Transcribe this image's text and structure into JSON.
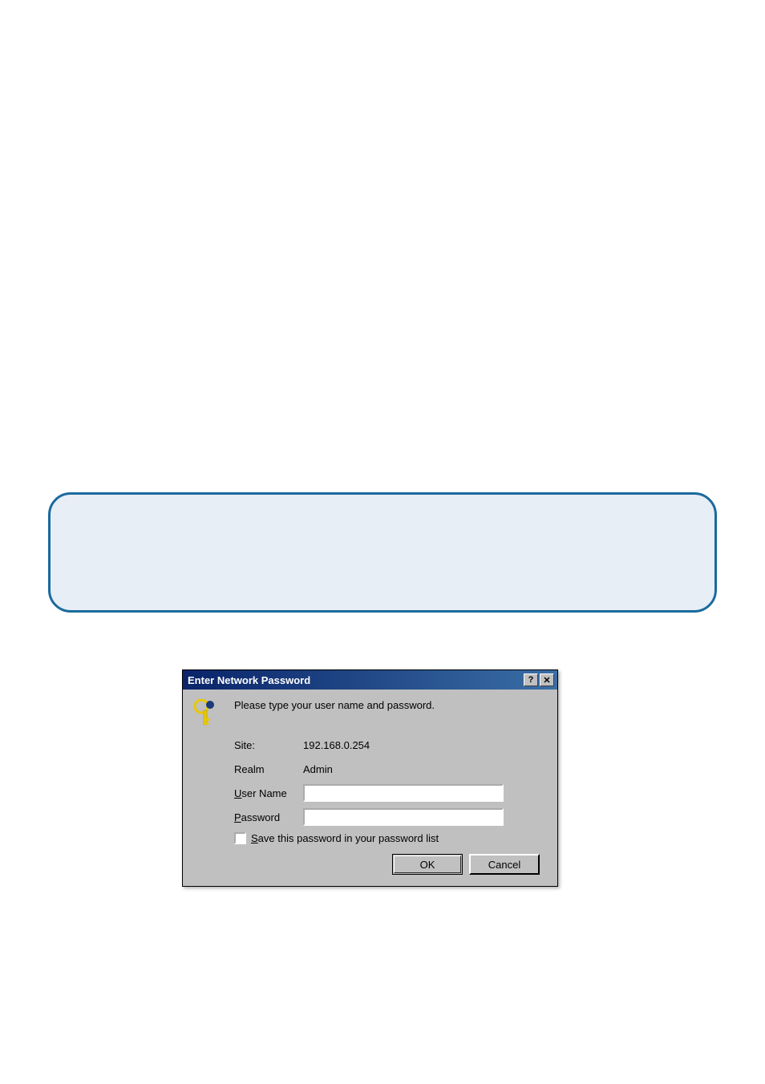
{
  "dialog": {
    "title": "Enter Network Password",
    "help_glyph": "?",
    "close_glyph": "✕",
    "prompt": "Please type your user name and password.",
    "rows": {
      "site_label": "Site:",
      "site_value": "192.168.0.254",
      "realm_label": "Realm",
      "realm_value": "Admin",
      "username_label": "User Name",
      "password_label": "Password"
    },
    "checkbox_label": "Save this password in your password list",
    "ok_label": "OK",
    "cancel_label": "Cancel",
    "username_value": "",
    "password_value": ""
  }
}
